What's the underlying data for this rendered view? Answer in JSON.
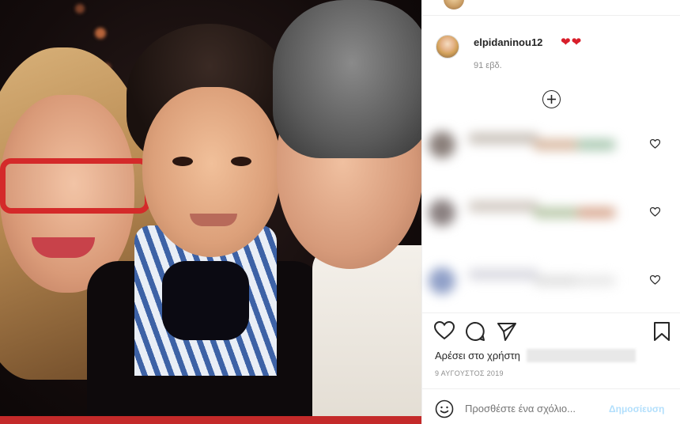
{
  "post": {
    "username": "elpidaninou12",
    "hearts": "❤❤",
    "age": "91 εβδ.",
    "likes_prefix": "Αρέσει στο χρήστη",
    "date": "9 ΑΥΓΟΥΣΤΟΣ 2019"
  },
  "comments": {
    "load_more_icon": "plus-circle-icon",
    "items": [
      {
        "like_icon": "heart-outline-icon",
        "avatar_color": "#8a7f7a",
        "colors": [
          "#c8c0b8",
          "#d8b8a0",
          "#a8c8b0"
        ]
      },
      {
        "like_icon": "heart-outline-icon",
        "avatar_color": "#8a8080",
        "colors": [
          "#d0c8c0",
          "#b8c8a8",
          "#d8a890"
        ]
      },
      {
        "like_icon": "heart-outline-icon",
        "avatar_color": "#90a0c8",
        "colors": [
          "#d8d8e0",
          "#e0e0e0",
          "#e8e8e8"
        ]
      }
    ]
  },
  "actions": {
    "like_icon": "heart-outline-icon",
    "comment_icon": "comment-icon",
    "share_icon": "paper-plane-icon",
    "save_icon": "bookmark-icon"
  },
  "add_comment": {
    "placeholder": "Προσθέστε ένα σχόλιο...",
    "post_label": "Δημοσίευση",
    "emoji_icon": "smiley-icon"
  },
  "colors": {
    "heart_red": "#d81e2a",
    "post_button_disabled": "#b2dffc",
    "text_primary": "#262626",
    "text_secondary": "#8e8e8e"
  }
}
